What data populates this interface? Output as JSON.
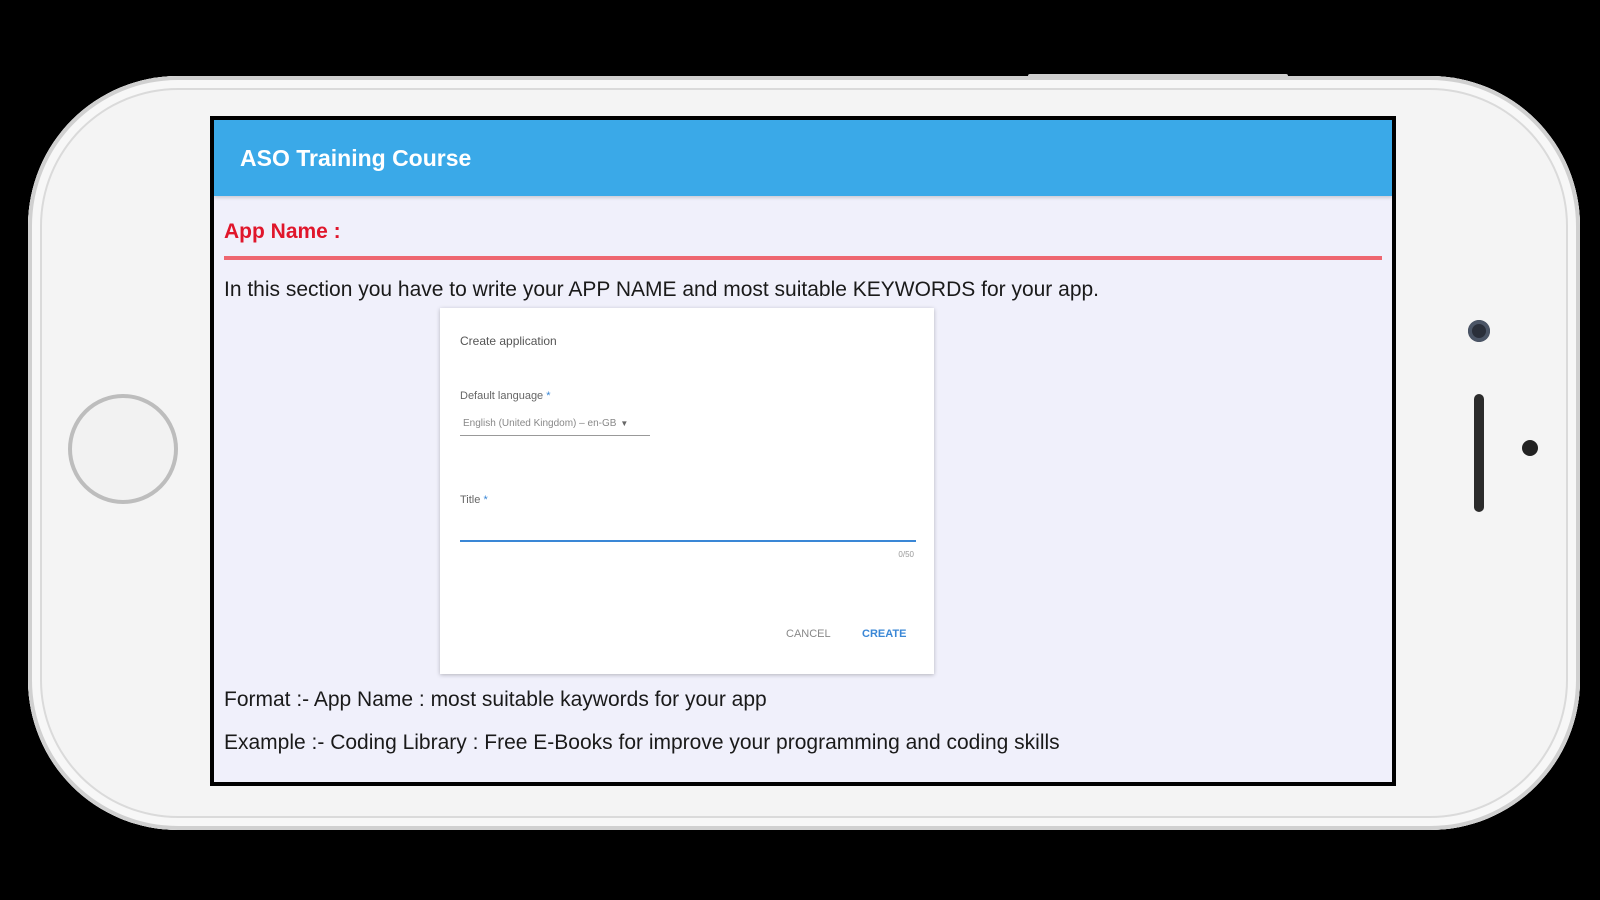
{
  "app": {
    "title": "ASO Training Course"
  },
  "section": {
    "heading": "App Name :",
    "description": "In this section you have to write your APP NAME and most suitable KEYWORDS for your app.",
    "format": "Format :- App Name : most suitable kaywords for your app",
    "example": "Example :- Coding Library : Free E-Books for improve your programming and coding skills"
  },
  "dialog": {
    "title": "Create application",
    "language_label": "Default language",
    "language_value": "English (United Kingdom) – en-GB",
    "required_marker": "*",
    "title_label": "Title",
    "title_value": "",
    "char_counter": "0/50",
    "cancel_label": "CANCEL",
    "create_label": "CREATE"
  },
  "colors": {
    "app_bar": "#3aa9e8",
    "heading": "#e0162b",
    "divider": "#ee6670",
    "screen_background": "#f0f0fb",
    "accent": "#3a87d6"
  },
  "icons": {
    "dropdown": "chevron-down-icon"
  }
}
